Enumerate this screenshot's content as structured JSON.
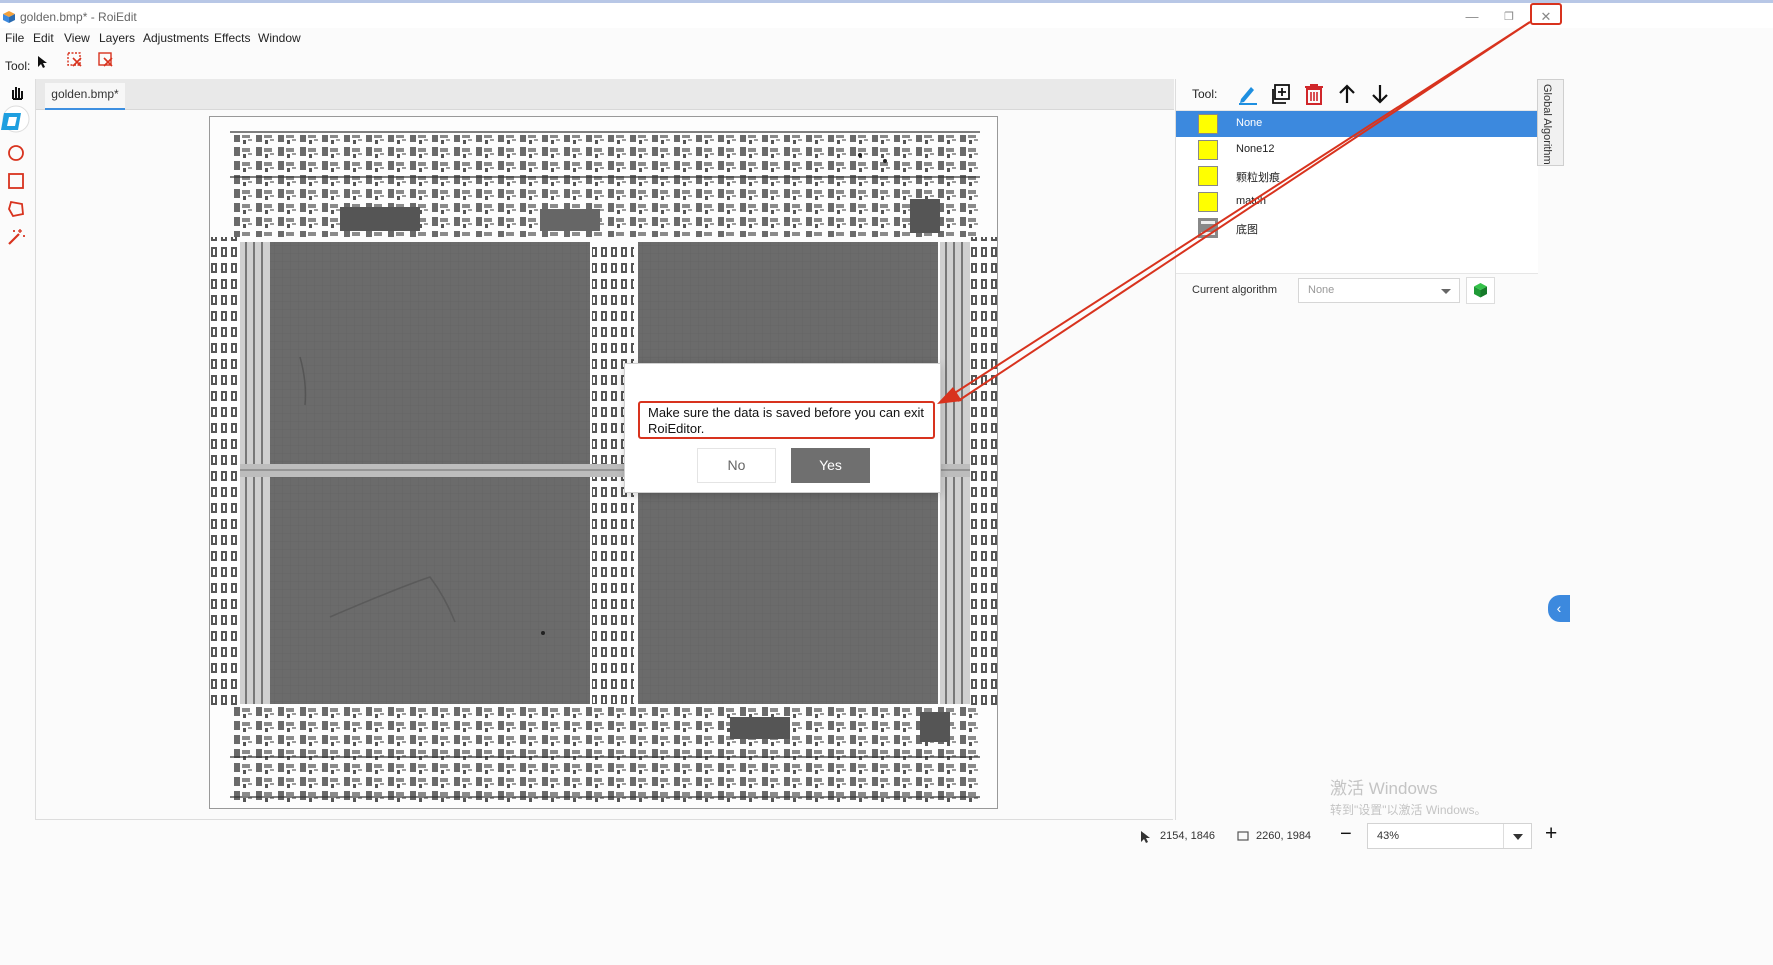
{
  "window": {
    "title": "golden.bmp* - RoiEdit",
    "minimize_glyph": "—",
    "restore_glyph": "❐",
    "close_glyph": "✕"
  },
  "menu": [
    "File",
    "Edit",
    "View",
    "Layers",
    "Adjustments",
    "Effects",
    "Window"
  ],
  "toolbar": {
    "tool_label": "Tool:"
  },
  "document": {
    "tab_label": "golden.bmp*"
  },
  "right_panel": {
    "tool_label": "Tool:",
    "layers": [
      {
        "name": "None",
        "selected": true,
        "swatch": "#ffff00"
      },
      {
        "name": "None12",
        "selected": false,
        "swatch": "#ffff00"
      },
      {
        "name": "颗粒划痕",
        "selected": false,
        "swatch": "#ffff00"
      },
      {
        "name": "match",
        "selected": false,
        "swatch": "#ffff00"
      },
      {
        "name": "底图",
        "selected": false,
        "swatch": "image"
      }
    ],
    "current_algorithm_label": "Current algorithm",
    "current_algorithm_value": "None",
    "global_algorithm_tab": "Global Algorithm"
  },
  "dialog": {
    "message": "Make sure the data is saved before you can exit RoiEditor.",
    "no_label": "No",
    "yes_label": "Yes"
  },
  "statusbar": {
    "cursor_position": "2154, 1846",
    "selection_size": "2260, 1984",
    "zoom": "43%",
    "zoom_out": "−",
    "zoom_in": "+"
  },
  "watermark": {
    "line1": "激活 Windows",
    "line2": "转到\"设置\"以激活 Windows。"
  },
  "colors": {
    "accent": "#3c89de",
    "annotation": "#d8331e",
    "delete": "#d0262a"
  }
}
